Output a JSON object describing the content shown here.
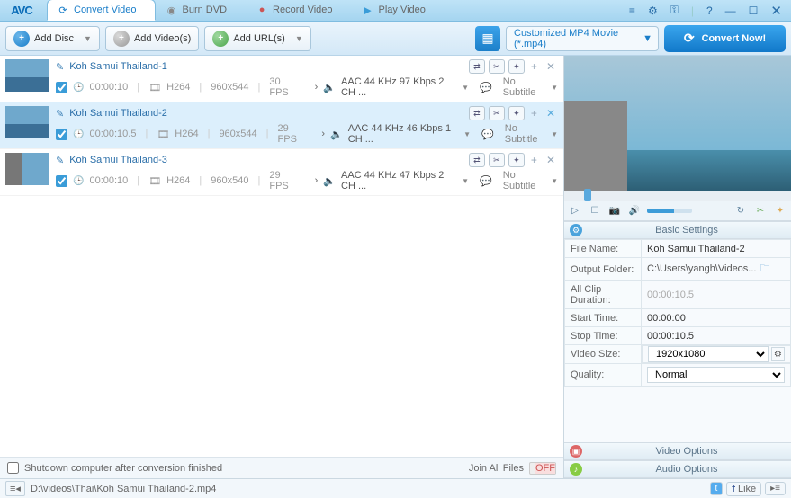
{
  "app": {
    "logo": "AVC"
  },
  "tabs": [
    {
      "label": "Convert Video",
      "active": true
    },
    {
      "label": "Burn DVD",
      "active": false
    },
    {
      "label": "Record Video",
      "active": false
    },
    {
      "label": "Play Video",
      "active": false
    }
  ],
  "toolbar": {
    "add_disc": "Add Disc",
    "add_videos": "Add Video(s)",
    "add_urls": "Add URL(s)",
    "output_format": "Customized MP4 Movie (*.mp4)",
    "convert": "Convert Now!"
  },
  "videos": [
    {
      "name": "Koh Samui Thailand-1",
      "checked": true,
      "duration": "00:00:10",
      "codec": "H264",
      "res": "960x544",
      "fps": "30 FPS",
      "audio": "AAC 44 KHz 97 Kbps 2 CH ...",
      "subtitle": "No Subtitle",
      "selected": false
    },
    {
      "name": "Koh Samui Thailand-2",
      "checked": true,
      "duration": "00:00:10.5",
      "codec": "H264",
      "res": "960x544",
      "fps": "29 FPS",
      "audio": "AAC 44 KHz 46 Kbps 1 CH ...",
      "subtitle": "No Subtitle",
      "selected": true
    },
    {
      "name": "Koh Samui Thailand-3",
      "checked": true,
      "duration": "00:00:10",
      "codec": "H264",
      "res": "960x540",
      "fps": "29 FPS",
      "audio": "AAC 44 KHz 47 Kbps 2 CH ...",
      "subtitle": "No Subtitle",
      "selected": false
    }
  ],
  "listfooter": {
    "shutdown": "Shutdown computer after conversion finished",
    "join": "Join All Files",
    "toggle_off": "OFF"
  },
  "settings": {
    "head": "Basic Settings",
    "fields": {
      "file_name_lbl": "File Name:",
      "file_name": "Koh Samui Thailand-2",
      "output_lbl": "Output Folder:",
      "output": "C:\\Users\\yangh\\Videos...",
      "clip_lbl": "All Clip Duration:",
      "clip": "00:00:10.5",
      "start_lbl": "Start Time:",
      "start": "00:00:00",
      "stop_lbl": "Stop Time:",
      "stop": "00:00:10.5",
      "size_lbl": "Video Size:",
      "size": "1920x1080",
      "quality_lbl": "Quality:",
      "quality": "Normal"
    },
    "video_options": "Video Options",
    "audio_options": "Audio Options"
  },
  "bottom": {
    "path": "D:\\videos\\Thai\\Koh Samui Thailand-2.mp4",
    "like": "Like"
  }
}
